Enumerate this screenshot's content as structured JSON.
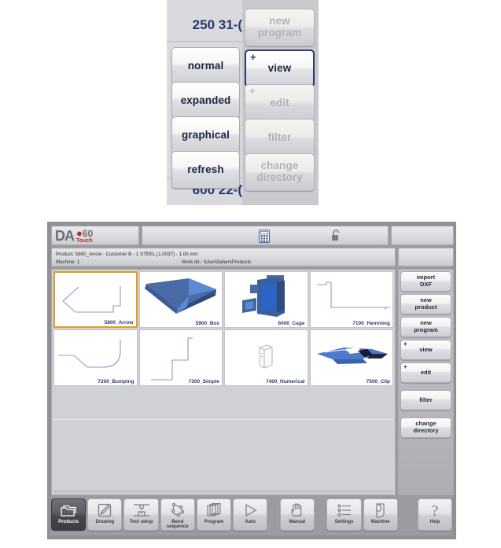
{
  "overlay": {
    "readout_top": "250 31-(",
    "readout_bottom": "600 22-(",
    "buttons_left": [
      {
        "label": "normal"
      },
      {
        "label": "expanded"
      },
      {
        "label": "graphical"
      },
      {
        "label": "refresh"
      }
    ],
    "buttons_right": [
      {
        "label": "new\nprogram",
        "line1": "new",
        "line2": "program",
        "state": "disabled",
        "plus": false
      },
      {
        "label": "view",
        "line1": "view",
        "line2": "",
        "state": "selected",
        "plus": true
      },
      {
        "label": "edit",
        "line1": "edit",
        "line2": "",
        "state": "disabled",
        "plus": true
      },
      {
        "label": "filter",
        "line1": "filter",
        "line2": "",
        "state": "disabled",
        "plus": false
      },
      {
        "label": "change directory",
        "line1": "change",
        "line2": "directory",
        "state": "disabled",
        "plus": false
      }
    ]
  },
  "app": {
    "logo": {
      "da": "DA",
      "sixty": "60",
      "touch": "Touch"
    },
    "header_icons": [
      {
        "name": "calculator-icon"
      },
      {
        "name": "unlock-icon"
      }
    ],
    "info": {
      "product_line": "Product: 5800_Arrow - Customer B - 1 STEEL (1.0037) - 1.00 mm",
      "machine_line": "Machine: 1",
      "workdir_line": "Work dir.: \\User\\Delem\\Products"
    },
    "products": [
      {
        "label": "5800_Arrow",
        "thumb": "arrow-outline",
        "selected": true
      },
      {
        "label": "5900_Box",
        "thumb": "box-3d",
        "selected": false
      },
      {
        "label": "6000_Cage",
        "thumb": "cage-3d",
        "selected": false
      },
      {
        "label": "7100_Hemming",
        "thumb": "hemming-outline",
        "selected": false
      },
      {
        "label": "7200_Bumping",
        "thumb": "bumping-outline",
        "selected": false
      },
      {
        "label": "7300_Simple",
        "thumb": "simple-outline",
        "selected": false
      },
      {
        "label": "7400_Numerical",
        "thumb": "numerical-3d",
        "selected": false
      },
      {
        "label": "7500_Clip",
        "thumb": "clip-3d",
        "selected": false
      }
    ],
    "sidebar": [
      {
        "line1": "import",
        "line2": "DXF",
        "plus": false
      },
      {
        "line1": "new",
        "line2": "product",
        "plus": false
      },
      {
        "line1": "new",
        "line2": "program",
        "plus": false
      },
      {
        "line1": "view",
        "line2": "",
        "plus": true
      },
      {
        "line1": "edit",
        "line2": "",
        "plus": true
      },
      {
        "line1": "filter",
        "line2": "",
        "plus": false
      },
      {
        "line1": "change",
        "line2": "directory",
        "plus": false
      }
    ],
    "toolbar": [
      {
        "label": "Products",
        "line1": "Products",
        "line2": "",
        "icon": "folder-icon",
        "active": true
      },
      {
        "label": "Drawing",
        "line1": "Drawing",
        "line2": "",
        "icon": "pencil-page-icon",
        "active": false
      },
      {
        "label": "Tool setup",
        "line1": "Tool setup",
        "line2": "",
        "icon": "tool-press-icon",
        "active": false
      },
      {
        "label": "Bend sequence",
        "line1": "Bend",
        "line2": "sequence",
        "icon": "bend-nodes-icon",
        "active": false
      },
      {
        "label": "Program",
        "line1": "Program",
        "line2": "",
        "icon": "pages-stack-icon",
        "active": false
      },
      {
        "label": "Auto",
        "line1": "Auto",
        "line2": "",
        "icon": "play-triangle-icon",
        "active": false
      },
      {
        "label": "Manual",
        "line1": "Manual",
        "line2": "",
        "icon": "hand-icon",
        "active": false
      },
      {
        "label": "Settings",
        "line1": "Settings",
        "line2": "",
        "icon": "list-settings-icon",
        "active": false
      },
      {
        "label": "Machine",
        "line1": "Machine",
        "line2": "",
        "icon": "machine-page-icon",
        "active": false
      },
      {
        "label": "Help",
        "line1": "Help",
        "line2": "",
        "icon": "question-mark-icon",
        "active": false
      }
    ],
    "colors": {
      "selection_orange": "#e39b22",
      "label_blue": "#2f3b74",
      "logo_red": "#c0272d",
      "part_blue": "#3d62a8"
    }
  }
}
